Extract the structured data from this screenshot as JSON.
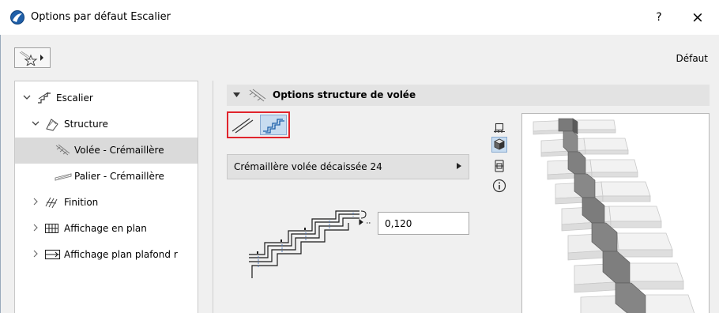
{
  "window": {
    "title": "Options par défaut Escalier",
    "help_label": "?",
    "close_label": "×"
  },
  "toolbar": {
    "preset_label": "Défaut",
    "favorites_icon": "favorites-star-icon"
  },
  "tree": {
    "items": [
      {
        "label": "Escalier",
        "icon": "stair-icon",
        "expanded": true
      },
      {
        "label": "Structure",
        "icon": "structure-icon",
        "expanded": true
      },
      {
        "label": "Volée - Crémaillère",
        "icon": "flight-icon",
        "selected": true
      },
      {
        "label": "Palier - Crémaillère",
        "icon": "landing-icon"
      },
      {
        "label": "Finition",
        "icon": "finish-icon",
        "expanded": false
      },
      {
        "label": "Affichage en plan",
        "icon": "plan-display-icon",
        "expanded": false
      },
      {
        "label": "Affichage plan plafond r",
        "icon": "ceiling-plan-icon",
        "expanded": false
      }
    ]
  },
  "section": {
    "title": "Options structure de volée",
    "structure_types": [
      "plain-stringer-icon",
      "stepped-stringer-icon"
    ],
    "active_type": 1,
    "profile_name": "Crémaillère volée décaissée 24",
    "thickness_value": "0,120",
    "view_icons": [
      "plan-view-icon",
      "3d-view-icon",
      "section-view-icon",
      "info-icon"
    ],
    "accent": "#e0242c",
    "selection_color": "#c7dcf0"
  }
}
